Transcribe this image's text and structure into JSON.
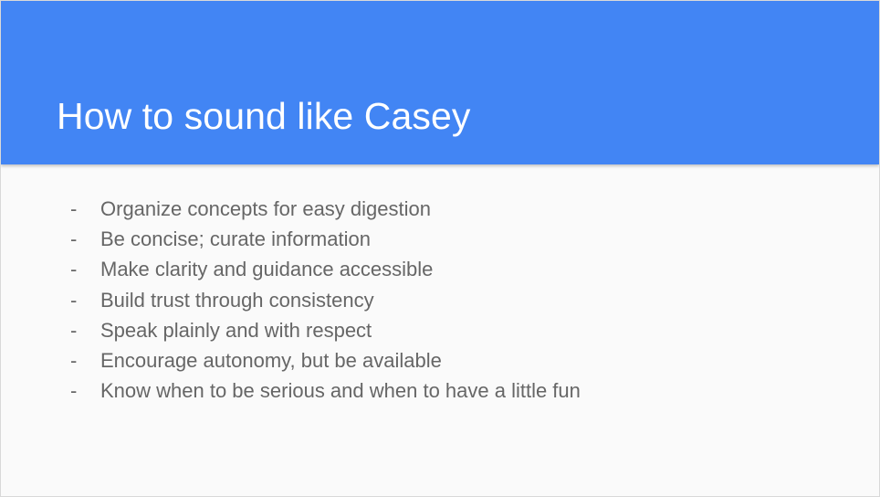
{
  "slide": {
    "title": "How to sound like Casey",
    "header_color": "#4285f4",
    "bullet_marker": "-",
    "bullets": [
      "Organize concepts for easy digestion",
      "Be concise; curate information",
      "Make clarity and guidance accessible",
      "Build trust through consistency",
      "Speak plainly and with respect",
      "Encourage autonomy, but be available",
      "Know when to be serious and when to have a little fun"
    ]
  }
}
